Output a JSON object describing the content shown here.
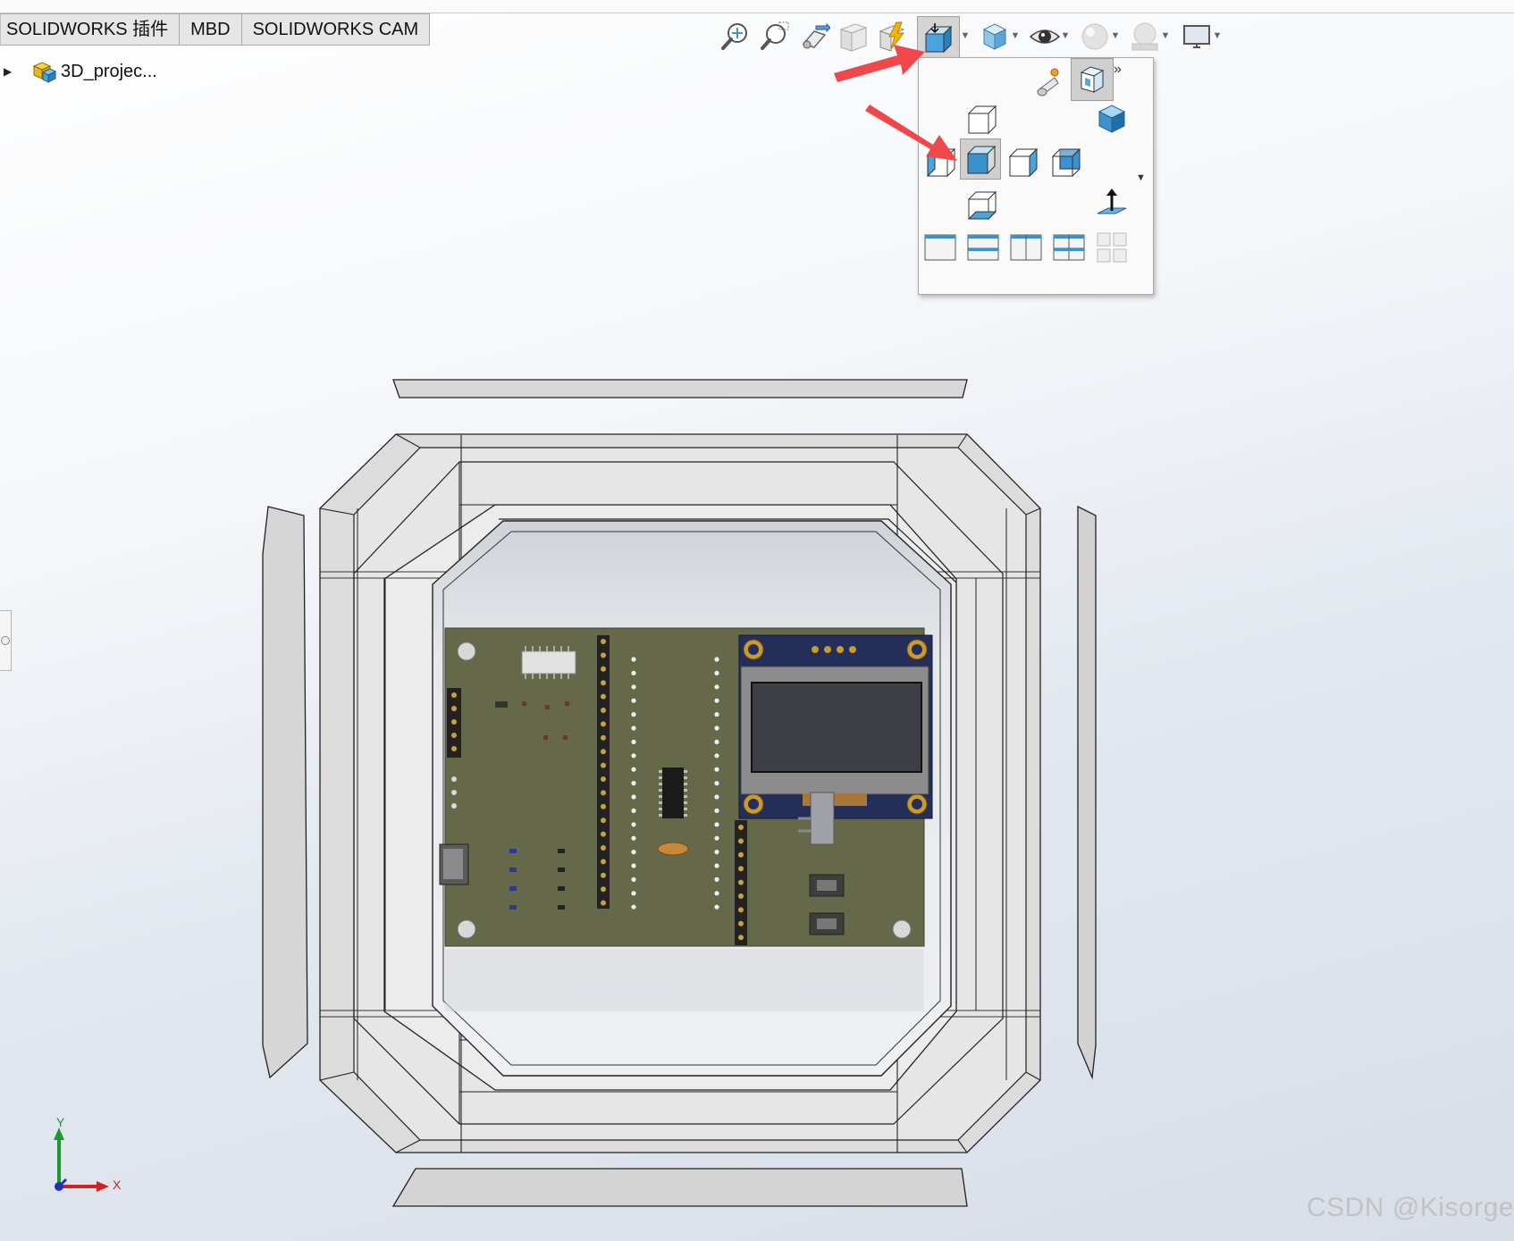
{
  "tabs": [
    {
      "label": "SOLIDWORKS 插件"
    },
    {
      "label": "MBD"
    },
    {
      "label": "SOLIDWORKS CAM"
    }
  ],
  "feature_tree": {
    "root_label": "3D_projec..."
  },
  "toolbar": {
    "icons": [
      "zoom-to-fit-icon",
      "zoom-to-area-icon",
      "previous-view-icon",
      "section-view-icon",
      "dynamic-annotation-icon",
      "view-orientation-icon",
      "display-style-icon",
      "hide-show-icon",
      "edit-appearance-icon",
      "apply-scene-icon",
      "view-settings-icon"
    ]
  },
  "view_orientation_flyout": {
    "more_label": "»",
    "icons": [
      "view-selector-icon",
      "front-view-icon",
      "isometric-view-icon",
      "left-view-icon",
      "top-view-icon",
      "right-view-icon",
      "back-view-icon",
      "bottom-view-icon",
      "normal-to-icon",
      "single-view-icon",
      "two-view-horizontal-icon",
      "two-view-vertical-icon",
      "four-view-icon",
      "link-views-icon"
    ],
    "selected": "top-view-icon"
  },
  "annotations": {
    "arrow_color": "#f0484a"
  },
  "triad": {
    "x_label": "X",
    "y_label": "Y",
    "x_color": "#d02020",
    "y_color": "#1a9a2a",
    "z_color": "#2030c0"
  },
  "watermark": "CSDN @Kisorge"
}
